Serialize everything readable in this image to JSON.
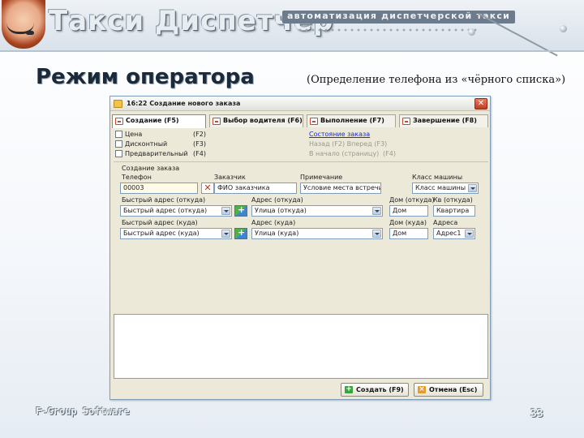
{
  "header": {
    "brand_title": "Такси Диспетчер",
    "tagline": "автоматизация диспетчерской такси"
  },
  "slide": {
    "title": "Режим оператора",
    "subtitle": "(Определение телефона из «чёрного списка»)",
    "footer": "F-Group Software",
    "page_number": "33"
  },
  "window": {
    "title": "16:22 Создание нового заказа",
    "close_label": "✕",
    "tabs": [
      {
        "label": "Создание (F5)"
      },
      {
        "label": "Выбор водителя (F6)"
      },
      {
        "label": "Выполнение (F7)"
      },
      {
        "label": "Завершение (F8)"
      }
    ],
    "options": [
      {
        "label": "Цена",
        "key": "(F2)"
      },
      {
        "label": "Дисконтный",
        "key": "(F3)"
      },
      {
        "label": "Предварительный",
        "key": "(F4)"
      }
    ],
    "order_status_link": "Состояние заказа",
    "back_forward": "Назад (F2) Вперед (F3)",
    "to_start": "В начало (страницу)",
    "to_start_key": "(F4)",
    "group_title": "Создание заказа",
    "fields": {
      "phone": {
        "label": "Телефон",
        "value": "00003"
      },
      "customer": {
        "label": "Заказчик",
        "value": "ФИО заказчика"
      },
      "note": {
        "label": "Примечание",
        "value": "Условие места встречи"
      },
      "car_class": {
        "label": "Класс машины",
        "value": "Класс машины"
      },
      "quick_from": {
        "label": "Быстрый адрес (откуда)",
        "value": "Быстрый адрес (откуда)"
      },
      "addr_from": {
        "label": "Адрес (откуда)",
        "value": "Улица (откуда)"
      },
      "house_from": {
        "label": "Дом (откуда)",
        "value": "Дом"
      },
      "apt_from": {
        "label": "Кв (откуда)",
        "value": "Квартира"
      },
      "quick_to": {
        "label": "Быстрый адрес (куда)",
        "value": "Быстрый адрес (куда)"
      },
      "addr_to": {
        "label": "Адрес (куда)",
        "value": "Улица (куда)"
      },
      "house_to": {
        "label": "Дом (куда)",
        "value": "Дом"
      },
      "addresses": {
        "label": "Адреса",
        "value": "Адрес1"
      }
    },
    "buttons": {
      "create": "Создать (F9)",
      "cancel": "Отмена (Esc)"
    }
  }
}
